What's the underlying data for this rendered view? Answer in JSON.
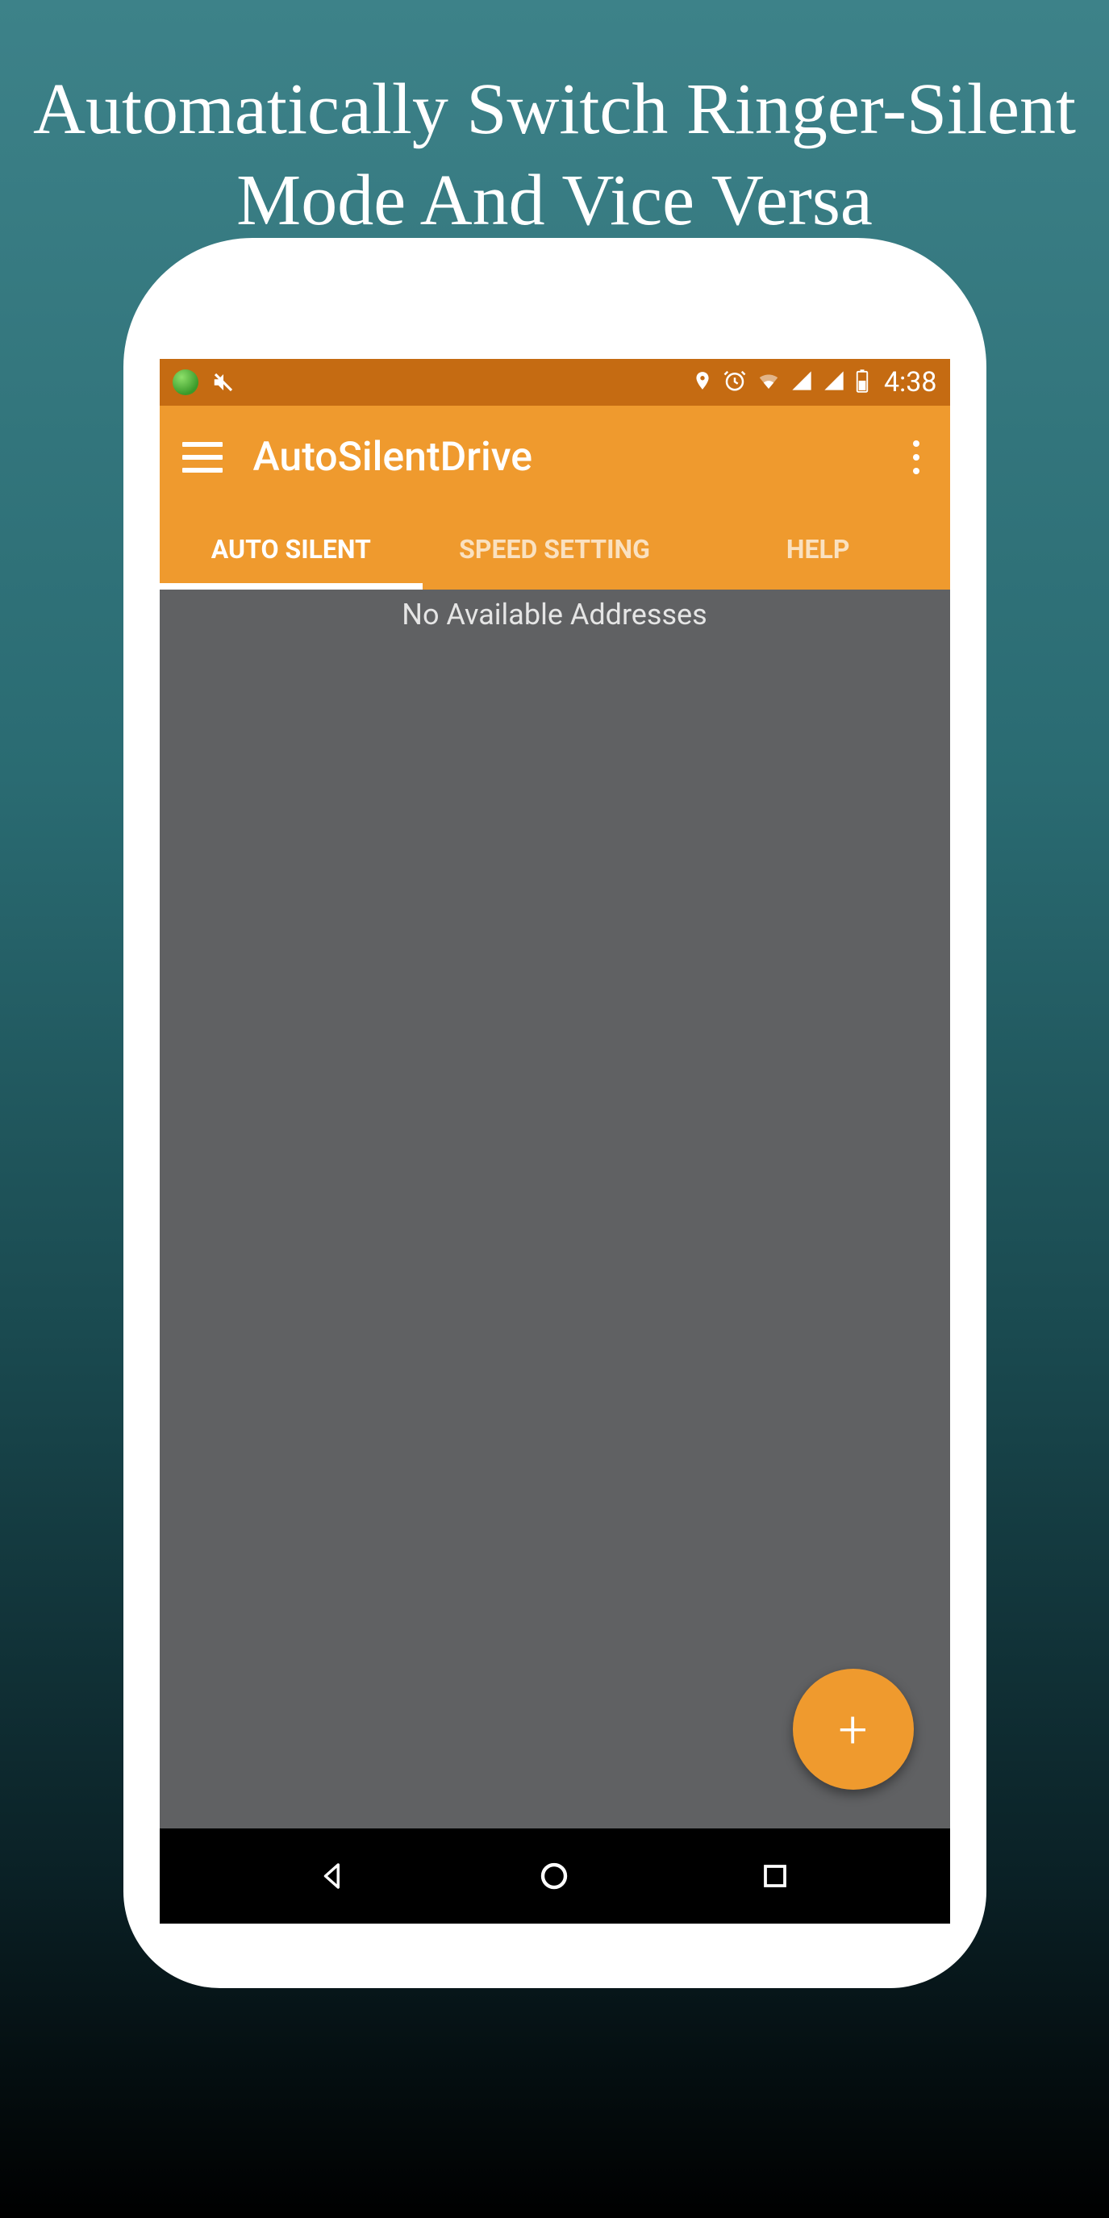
{
  "promo": {
    "headline": "Automatically Switch Ringer-Silent Mode And Vice Versa"
  },
  "status_bar": {
    "time": "4:38",
    "icons": {
      "globe": "globe-icon",
      "mute": "mute-icon",
      "location": "location-icon",
      "alarm": "alarm-icon",
      "wifi": "wifi-icon",
      "signal1": "signal-icon",
      "signal2": "signal-icon",
      "battery": "battery-icon"
    }
  },
  "app_bar": {
    "title": "AutoSilentDrive"
  },
  "tabs": [
    {
      "label": "AUTO SILENT",
      "active": true
    },
    {
      "label": "SPEED SETTING",
      "active": false
    },
    {
      "label": "HELP",
      "active": false
    }
  ],
  "content": {
    "empty_message": "No Available Addresses"
  },
  "fab": {
    "label": "+"
  },
  "colors": {
    "accent": "#ef9a2e",
    "accent_dark": "#c56b12",
    "content_bg": "#606163"
  }
}
